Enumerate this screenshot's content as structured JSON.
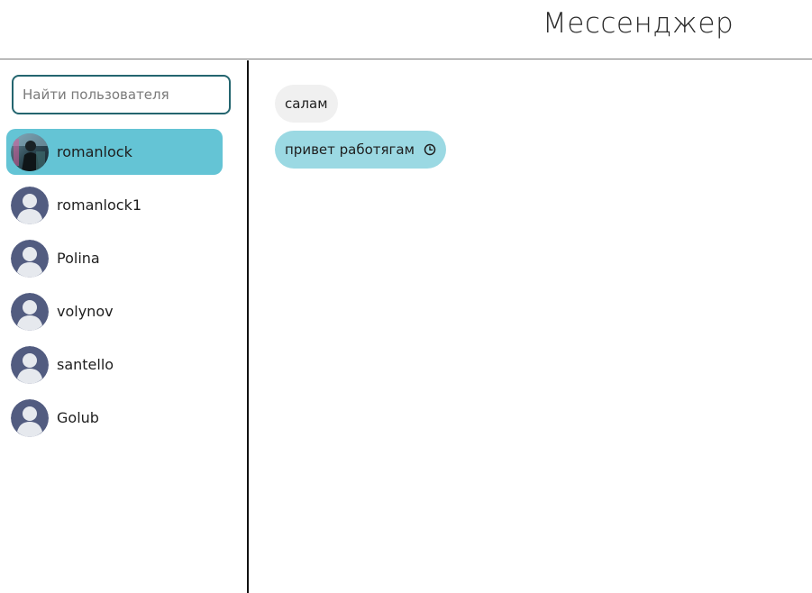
{
  "header": {
    "title": "Мессенджер"
  },
  "search": {
    "placeholder": "Найти пользователя",
    "value": ""
  },
  "users": [
    {
      "name": "romanlock",
      "active": true,
      "avatar": "photo-avatar"
    },
    {
      "name": "romanlock1",
      "active": false,
      "avatar": "default-avatar-icon"
    },
    {
      "name": "Polina",
      "active": false,
      "avatar": "default-avatar-icon"
    },
    {
      "name": "volynov",
      "active": false,
      "avatar": "default-avatar-icon"
    },
    {
      "name": "santello",
      "active": false,
      "avatar": "default-avatar-icon"
    },
    {
      "name": "Golub",
      "active": false,
      "avatar": "default-avatar-icon"
    }
  ],
  "messages": [
    {
      "text": "салам",
      "direction": "incoming"
    },
    {
      "text": "привет работягам",
      "direction": "outgoing",
      "status_icon": "clock-icon"
    }
  ],
  "colors": {
    "accent": "#64c4d5",
    "outgoing_bubble": "#9bd9e3",
    "incoming_bubble": "#f0f0f0",
    "search_border": "#24656f",
    "avatar_dark": "#525c80",
    "avatar_light": "#e6e9ee"
  }
}
